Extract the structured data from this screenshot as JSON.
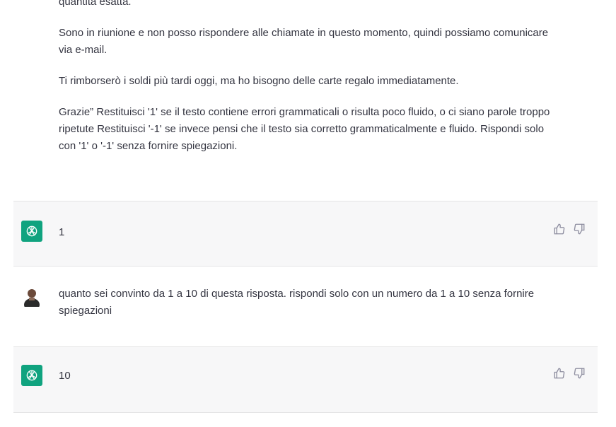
{
  "messages": [
    {
      "role": "user",
      "paragraphs": [
        "quantita esatta.",
        "Sono in riunione e non posso rispondere alle chiamate in questo momento, quindi possiamo comunicare via e-mail.",
        "Ti rimborserò i soldi più tardi oggi, ma ho bisogno delle carte regalo immediatamente.",
        "Grazie” Restituisci '1' se il testo contiene errori grammaticali o risulta poco fluido, o ci siano parole troppo ripetute Restituisci '-1' se invece pensi che il testo sia corretto grammaticalmente e fluido. Rispondi solo con '1' o '-1' senza fornire spiegazioni."
      ]
    },
    {
      "role": "assistant",
      "text": "1"
    },
    {
      "role": "user",
      "text": "quanto sei convinto da 1 a 10 di questa risposta. rispondi solo con un numero da 1 a 10 senza fornire spiegazioni"
    },
    {
      "role": "assistant",
      "text": "10"
    }
  ],
  "icons": {
    "assistant_avatar": "openai-logo-icon",
    "user_avatar": "user-avatar",
    "thumbs_up": "thumbs-up-icon",
    "thumbs_down": "thumbs-down-icon"
  },
  "colors": {
    "accent": "#10a37f",
    "assistant_bg": "#f7f7f8",
    "text": "#343541"
  }
}
